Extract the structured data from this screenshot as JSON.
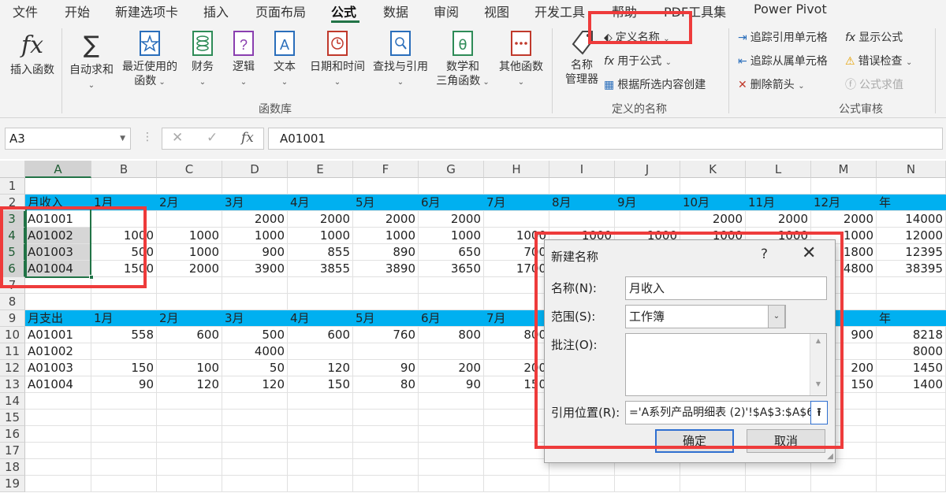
{
  "tabs": [
    "文件",
    "开始",
    "新建选项卡",
    "插入",
    "页面布局",
    "公式",
    "数据",
    "审阅",
    "视图",
    "开发工具",
    "帮助",
    "PDF工具集",
    "Power Pivot"
  ],
  "active_tab": "公式",
  "ribbon": {
    "insert_function": "插入函数",
    "autosum": "自动求和",
    "recent_l1": "最近使用的",
    "recent_l2": "函数",
    "financial": "财务",
    "logical": "逻辑",
    "text": "文本",
    "datetime": "日期和时间",
    "lookup": "查找与引用",
    "math_l1": "数学和",
    "math_l2": "三角函数",
    "more": "其他函数",
    "group_function_library": "函数库",
    "name_manager_l1": "名称",
    "name_manager_l2": "管理器",
    "define_name": "定义名称",
    "use_in_formula": "用于公式",
    "create_from_selection": "根据所选内容创建",
    "group_defined_names": "定义的名称",
    "trace_precedents": "追踪引用单元格",
    "trace_dependents": "追踪从属单元格",
    "remove_arrows": "删除箭头",
    "show_formulas": "显示公式",
    "error_checking": "错误检查",
    "evaluate_formula": "公式求值",
    "group_formula_auditing": "公式审核"
  },
  "formula_bar": {
    "name_box": "A3",
    "fx": "fx",
    "content": "A01001"
  },
  "columns": [
    "A",
    "B",
    "C",
    "D",
    "E",
    "F",
    "G",
    "H",
    "I",
    "J",
    "K",
    "L",
    "M",
    "N"
  ],
  "rows": [
    {
      "n": "1",
      "cells": [
        "",
        "",
        "",
        "",
        "",
        "",
        "",
        "",
        "",
        "",
        "",
        "",
        "",
        ""
      ]
    },
    {
      "n": "2",
      "cells": [
        "月收入",
        "1月",
        "2月",
        "3月",
        "4月",
        "5月",
        "6月",
        "7月",
        "8月",
        "9月",
        "10月",
        "11月",
        "12月",
        "年"
      ]
    },
    {
      "n": "3",
      "cells": [
        "A01001",
        "",
        "",
        "2000",
        "2000",
        "2000",
        "2000",
        "",
        "",
        "",
        "2000",
        "2000",
        "2000",
        "14000"
      ]
    },
    {
      "n": "4",
      "cells": [
        "A01002",
        "1000",
        "1000",
        "1000",
        "1000",
        "1000",
        "1000",
        "1000",
        "1000",
        "1000",
        "1000",
        "1000",
        "1000",
        "12000"
      ]
    },
    {
      "n": "5",
      "cells": [
        "A01003",
        "500",
        "1000",
        "900",
        "855",
        "890",
        "650",
        "700",
        "",
        "",
        "",
        "",
        "1800",
        "12395"
      ]
    },
    {
      "n": "6",
      "cells": [
        "A01004",
        "1500",
        "2000",
        "3900",
        "3855",
        "3890",
        "3650",
        "1700",
        "",
        "",
        "",
        "",
        "4800",
        "38395"
      ]
    },
    {
      "n": "7",
      "cells": [
        "",
        "",
        "",
        "",
        "",
        "",
        "",
        "",
        "",
        "",
        "",
        "",
        "",
        ""
      ]
    },
    {
      "n": "8",
      "cells": [
        "",
        "",
        "",
        "",
        "",
        "",
        "",
        "",
        "",
        "",
        "",
        "",
        "",
        ""
      ]
    },
    {
      "n": "9",
      "cells": [
        "月支出",
        "1月",
        "2月",
        "3月",
        "4月",
        "5月",
        "6月",
        "7月",
        "",
        "",
        "",
        "",
        "",
        "年"
      ]
    },
    {
      "n": "10",
      "cells": [
        "A01001",
        "558",
        "600",
        "500",
        "600",
        "760",
        "800",
        "800",
        "",
        "",
        "",
        "",
        "900",
        "8218"
      ]
    },
    {
      "n": "11",
      "cells": [
        "A01002",
        "",
        "",
        "4000",
        "",
        "",
        "",
        "",
        "",
        "",
        "",
        "",
        "",
        "8000"
      ]
    },
    {
      "n": "12",
      "cells": [
        "A01003",
        "150",
        "100",
        "50",
        "120",
        "90",
        "200",
        "200",
        "",
        "",
        "",
        "",
        "200",
        "1450"
      ]
    },
    {
      "n": "13",
      "cells": [
        "A01004",
        "90",
        "120",
        "120",
        "150",
        "80",
        "90",
        "150",
        "",
        "",
        "",
        "",
        "150",
        "1400"
      ]
    },
    {
      "n": "14",
      "cells": [
        "",
        "",
        "",
        "",
        "",
        "",
        "",
        "",
        "",
        "",
        "",
        "",
        "",
        ""
      ]
    },
    {
      "n": "15",
      "cells": [
        "",
        "",
        "",
        "",
        "",
        "",
        "",
        "",
        "",
        "",
        "",
        "",
        "",
        ""
      ]
    },
    {
      "n": "16",
      "cells": [
        "",
        "",
        "",
        "",
        "",
        "",
        "",
        "",
        "",
        "",
        "",
        "",
        "",
        ""
      ]
    },
    {
      "n": "17",
      "cells": [
        "",
        "",
        "",
        "",
        "",
        "",
        "",
        "",
        "",
        "",
        "",
        "",
        "",
        ""
      ]
    },
    {
      "n": "18",
      "cells": [
        "",
        "",
        "",
        "",
        "",
        "",
        "",
        "",
        "",
        "",
        "",
        "",
        "",
        ""
      ]
    },
    {
      "n": "19",
      "cells": [
        "",
        "",
        "",
        "",
        "",
        "",
        "",
        "",
        "",
        "",
        "",
        "",
        "",
        ""
      ]
    }
  ],
  "dialog": {
    "title": "新建名称",
    "help": "?",
    "name_label": "名称(N):",
    "name_value": "月收入",
    "scope_label": "范围(S):",
    "scope_value": "工作簿",
    "comment_label": "批注(O):",
    "comment_value": "",
    "ref_label": "引用位置(R):",
    "ref_value": "='A系列产品明细表 (2)'!$A$3:$A$6",
    "ok": "确定",
    "cancel": "取消"
  },
  "colors": {
    "header_row_fill": "#00b0f0",
    "excel_green": "#217346",
    "highlight_red": "#ee3b3b"
  }
}
